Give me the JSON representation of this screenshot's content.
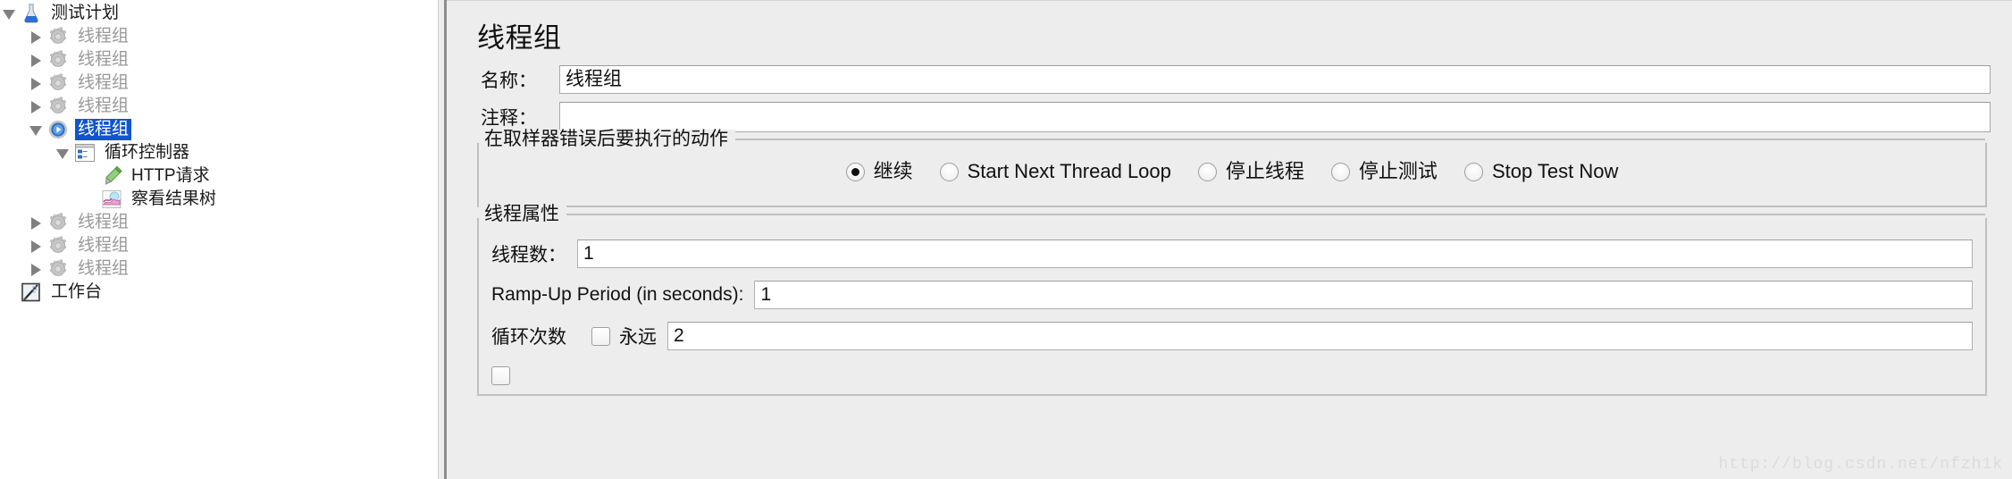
{
  "tree": {
    "items": [
      {
        "label": "测试计划",
        "icon": "flask-icon",
        "twisty": "expanded",
        "indent": 0,
        "selected": false,
        "dark": true
      },
      {
        "label": "线程组",
        "icon": "gear-icon",
        "twisty": "collapsed",
        "indent": 1,
        "selected": false,
        "dark": false
      },
      {
        "label": "线程组",
        "icon": "gear-icon",
        "twisty": "collapsed",
        "indent": 1,
        "selected": false,
        "dark": false
      },
      {
        "label": "线程组",
        "icon": "gear-icon",
        "twisty": "collapsed",
        "indent": 1,
        "selected": false,
        "dark": false
      },
      {
        "label": "线程组",
        "icon": "gear-icon",
        "twisty": "collapsed",
        "indent": 1,
        "selected": false,
        "dark": false
      },
      {
        "label": "线程组",
        "icon": "gear-running-icon",
        "twisty": "expanded",
        "indent": 1,
        "selected": true,
        "dark": false
      },
      {
        "label": "循环控制器",
        "icon": "loop-controller-icon",
        "twisty": "expanded",
        "indent": 2,
        "selected": false,
        "dark": true
      },
      {
        "label": "HTTP请求",
        "icon": "http-request-icon",
        "twisty": "none",
        "indent": 3,
        "selected": false,
        "dark": true
      },
      {
        "label": "察看结果树",
        "icon": "view-results-tree-icon",
        "twisty": "none",
        "indent": 3,
        "selected": false,
        "dark": true
      },
      {
        "label": "线程组",
        "icon": "gear-icon",
        "twisty": "collapsed",
        "indent": 1,
        "selected": false,
        "dark": false
      },
      {
        "label": "线程组",
        "icon": "gear-icon",
        "twisty": "collapsed",
        "indent": 1,
        "selected": false,
        "dark": false
      },
      {
        "label": "线程组",
        "icon": "gear-icon",
        "twisty": "collapsed",
        "indent": 1,
        "selected": false,
        "dark": false
      },
      {
        "label": "工作台",
        "icon": "workbench-icon",
        "twisty": "none",
        "indent": 0,
        "selected": false,
        "dark": true
      }
    ]
  },
  "panel": {
    "title": "线程组",
    "name_label": "名称：",
    "name_value": "线程组",
    "comment_label": "注释：",
    "comment_value": "",
    "comment_placeholder": "",
    "error_action": {
      "legend": "在取样器错误后要执行的动作",
      "options": [
        {
          "label": "继续",
          "checked": true
        },
        {
          "label": "Start Next Thread Loop",
          "checked": false
        },
        {
          "label": "停止线程",
          "checked": false
        },
        {
          "label": "停止测试",
          "checked": false
        },
        {
          "label": "Stop Test Now",
          "checked": false
        }
      ]
    },
    "thread_props": {
      "legend": "线程属性",
      "threads_label": "线程数：",
      "threads_value": "1",
      "rampup_label": "Ramp-Up Period (in seconds):",
      "rampup_value": "1",
      "loop_label": "循环次数",
      "forever_label": "永远",
      "forever_checked": false,
      "loop_value": "2"
    }
  },
  "watermark": "http://blog.csdn.net/nfzh1k",
  "colors": {
    "selection": "#1155cc",
    "panel_bg": "#ededed",
    "muted_text": "#999999"
  }
}
